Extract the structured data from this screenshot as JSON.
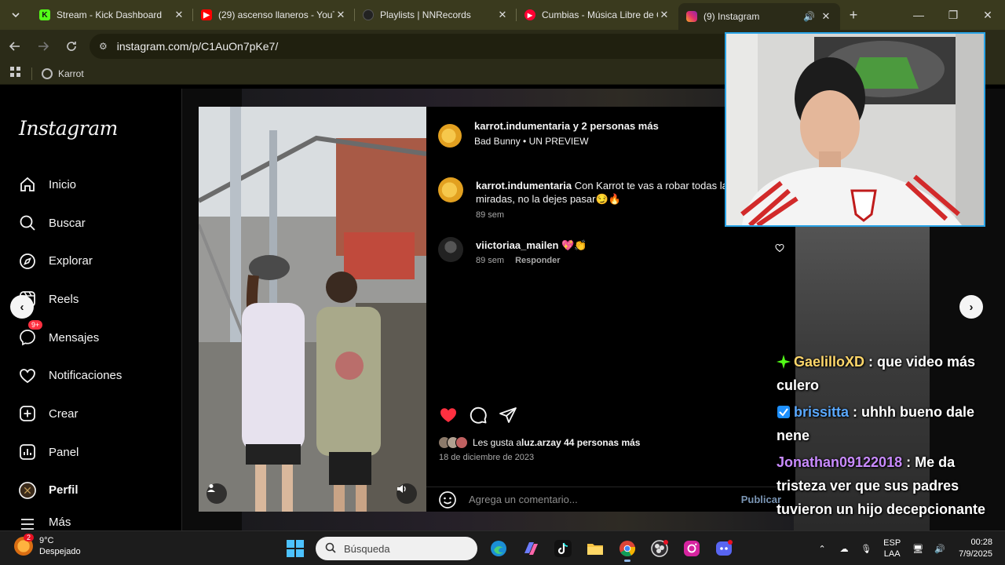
{
  "browser": {
    "tabs": [
      {
        "title": "Stream - Kick Dashboard",
        "icon": "kick-icon",
        "color": "#53fc18"
      },
      {
        "title": "(29) ascenso llaneros - YouTu",
        "icon": "youtube-icon",
        "color": "#ff0000"
      },
      {
        "title": "Playlists | NNRecords",
        "icon": "nnrecords-icon",
        "color": "#333333"
      },
      {
        "title": "Cumbias - Música Libre de Co",
        "icon": "youtube-music-icon",
        "color": "#ff0033"
      },
      {
        "title": "(9) Instagram",
        "icon": "instagram-icon",
        "color": "#e1306c",
        "active": true
      }
    ],
    "url": "instagram.com/p/C1AuOn7pKe7/",
    "bookmark": "Karrot"
  },
  "instagram": {
    "logo": "Instagram",
    "nav": [
      {
        "label": "Inicio",
        "icon": "home-icon"
      },
      {
        "label": "Buscar",
        "icon": "search-icon"
      },
      {
        "label": "Explorar",
        "icon": "compass-icon"
      },
      {
        "label": "Reels",
        "icon": "reels-icon"
      },
      {
        "label": "Mensajes",
        "icon": "messenger-icon",
        "badge": "9+"
      },
      {
        "label": "Notificaciones",
        "icon": "heart-icon"
      },
      {
        "label": "Crear",
        "icon": "plus-square-icon"
      },
      {
        "label": "Panel",
        "icon": "chart-icon"
      },
      {
        "label": "Perfil",
        "icon": "profile-avatar-icon"
      },
      {
        "label": "Más",
        "icon": "menu-icon"
      }
    ],
    "post": {
      "author_line": "karrot.indumentaria y 2 personas más",
      "audio_line": "Bad Bunny • UN PREVIEW",
      "caption_user": "karrot.indumentaria",
      "caption_text": "Con Karrot te vas a robar todas las miradas, no la dejes pasar😏🔥",
      "caption_time": "89 sem",
      "comment_user": "viictoriaa_mailen",
      "comment_text": "💖👏",
      "comment_time": "89 sem",
      "comment_reply": "Responder",
      "likes_prefix": "Les gusta a ",
      "likes_user": "luz.arza",
      "likes_rest": " y 44 personas más",
      "date": "18 de diciembre de 2023",
      "comment_placeholder": "Agrega un comentario...",
      "publish": "Publicar"
    }
  },
  "chat": [
    {
      "user": "GaelilloXD",
      "user_color": "#ffd76a",
      "badge": "green-diamond-badge",
      "text": " : que video más culero"
    },
    {
      "user": "brissitta",
      "user_color": "#5aa9ff",
      "badge": "blue-verified-badge",
      "text": " : uhhh bueno dale nene"
    },
    {
      "user": "Jonathan09122018",
      "user_color": "#c98bff",
      "badge": "",
      "text": " : Me da tristeza ver que sus padres tuvieron un hijo decepcionante"
    }
  ],
  "taskbar": {
    "weather_temp": "9°C",
    "weather_desc": "Despejado",
    "weather_badge": "2",
    "search_placeholder": "Búsqueda",
    "lang_top": "ESP",
    "lang_bottom": "LAA",
    "time": "00:28",
    "date": "7/9/2025"
  }
}
